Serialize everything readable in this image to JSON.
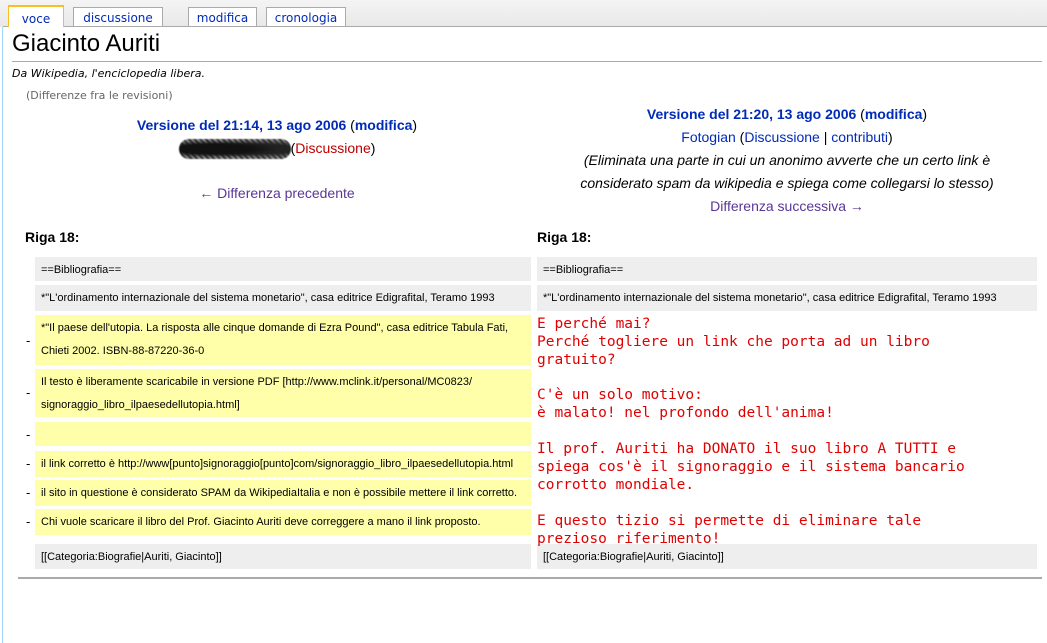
{
  "tabs": [
    {
      "label": "voce",
      "selected": true
    },
    {
      "label": "discussione",
      "selected": false
    },
    {
      "label": "modifica",
      "selected": false
    },
    {
      "label": "cronologia",
      "selected": false
    }
  ],
  "page": {
    "title": "Giacinto Auriti",
    "tagline": "Da Wikipedia, l'enciclopedia libera.",
    "subtitle": "(Differenze fra le revisioni)"
  },
  "left": {
    "version_text": "Versione del 21:14, 13 ago 2006",
    "edit_link": "modifica",
    "talk_link": "Discussione",
    "prev_link": "← Differenza precedente",
    "header": "Riga 18:"
  },
  "right": {
    "version_text": "Versione del 21:20, 13 ago 2006",
    "edit_link": "modifica",
    "user_link": "Fotogian",
    "talk_link": "Discussione",
    "contrib_link": "contributi",
    "summary_1": "(Eliminata una parte in cui un anonimo avverte che un certo link è",
    "summary_2": "considerato spam da wikipedia e spiega come collegarsi lo stesso)",
    "next_link": "Differenza successiva →",
    "header": "Riga 18:"
  },
  "diff": {
    "context_1": "==Bibliografia==",
    "context_2": "*\"L'ordinamento internazionale del sistema monetario\", casa editrice Edigrafital, Teramo 1993",
    "removed": [
      "*\"Il paese dell'utopia. La risposta alle cinque domande di Ezra Pound\", casa editrice Tabula Fati,",
      "Chieti 2002. ISBN-88-87220-36-0",
      "Il testo è liberamente scaricabile in versione PDF [http://www.mclink.it/personal/MC0823/",
      "signoraggio_libro_ilpaesedellutopia.html]",
      "",
      "il link corretto è http://www[punto]signoraggio[punto]com/signoraggio_libro_ilpaesedellutopia.html",
      "il sito in questione è considerato SPAM da WikipediaItalia e non è possibile mettere il link corretto.",
      "Chi vuole scaricare il libro del Prof. Giacinto Auriti deve correggere a mano il link proposto."
    ],
    "marker": "-",
    "context_3": "[[Categoria:Biografie|Auriti, Giacinto]]"
  },
  "annotation": {
    "p1": "E perché mai?\nPerché togliere un link che porta ad un libro\ngratuito?",
    "p2": "C'è un solo motivo:\nè malato! nel profondo dell'anima!",
    "p3": "Il prof. Auriti ha DONATO il suo libro A TUTTI e\nspiega cos'è il signoraggio e il sistema bancario\ncorrotto mondiale.",
    "p4": "E questo tizio si permette di eliminare tale\nprezioso riferimento!"
  },
  "colors": {
    "link": "#002bb8",
    "redlink": "#ba0000",
    "visited": "#5a3696",
    "removed_bg": "#ffffaa",
    "context_bg": "#eeeeee",
    "annotation": "#e00000"
  }
}
